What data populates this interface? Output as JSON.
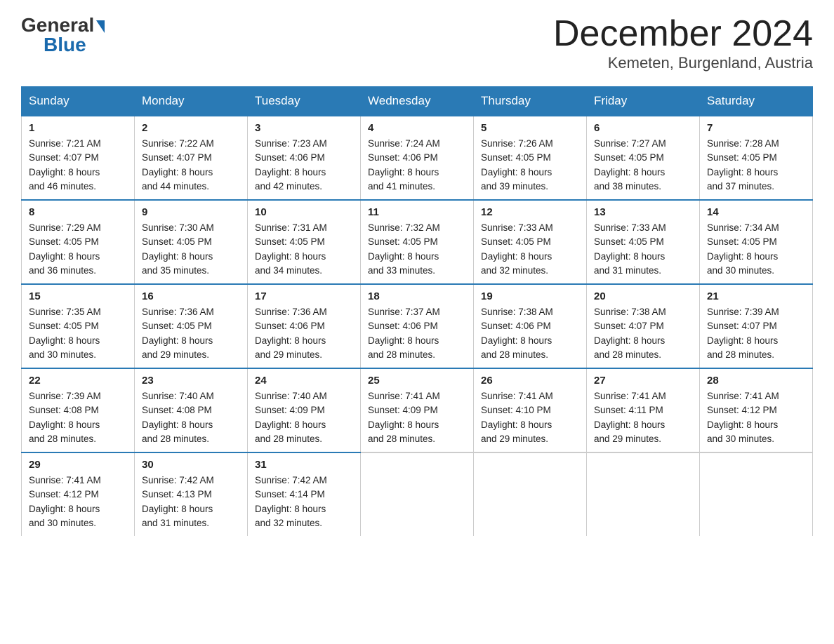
{
  "logo": {
    "general": "General",
    "blue": "Blue",
    "triangle": "▶"
  },
  "title": "December 2024",
  "location": "Kemeten, Burgenland, Austria",
  "days_of_week": [
    "Sunday",
    "Monday",
    "Tuesday",
    "Wednesday",
    "Thursday",
    "Friday",
    "Saturday"
  ],
  "weeks": [
    [
      {
        "day": "1",
        "sunrise": "7:21 AM",
        "sunset": "4:07 PM",
        "daylight": "8 hours and 46 minutes."
      },
      {
        "day": "2",
        "sunrise": "7:22 AM",
        "sunset": "4:07 PM",
        "daylight": "8 hours and 44 minutes."
      },
      {
        "day": "3",
        "sunrise": "7:23 AM",
        "sunset": "4:06 PM",
        "daylight": "8 hours and 42 minutes."
      },
      {
        "day": "4",
        "sunrise": "7:24 AM",
        "sunset": "4:06 PM",
        "daylight": "8 hours and 41 minutes."
      },
      {
        "day": "5",
        "sunrise": "7:26 AM",
        "sunset": "4:05 PM",
        "daylight": "8 hours and 39 minutes."
      },
      {
        "day": "6",
        "sunrise": "7:27 AM",
        "sunset": "4:05 PM",
        "daylight": "8 hours and 38 minutes."
      },
      {
        "day": "7",
        "sunrise": "7:28 AM",
        "sunset": "4:05 PM",
        "daylight": "8 hours and 37 minutes."
      }
    ],
    [
      {
        "day": "8",
        "sunrise": "7:29 AM",
        "sunset": "4:05 PM",
        "daylight": "8 hours and 36 minutes."
      },
      {
        "day": "9",
        "sunrise": "7:30 AM",
        "sunset": "4:05 PM",
        "daylight": "8 hours and 35 minutes."
      },
      {
        "day": "10",
        "sunrise": "7:31 AM",
        "sunset": "4:05 PM",
        "daylight": "8 hours and 34 minutes."
      },
      {
        "day": "11",
        "sunrise": "7:32 AM",
        "sunset": "4:05 PM",
        "daylight": "8 hours and 33 minutes."
      },
      {
        "day": "12",
        "sunrise": "7:33 AM",
        "sunset": "4:05 PM",
        "daylight": "8 hours and 32 minutes."
      },
      {
        "day": "13",
        "sunrise": "7:33 AM",
        "sunset": "4:05 PM",
        "daylight": "8 hours and 31 minutes."
      },
      {
        "day": "14",
        "sunrise": "7:34 AM",
        "sunset": "4:05 PM",
        "daylight": "8 hours and 30 minutes."
      }
    ],
    [
      {
        "day": "15",
        "sunrise": "7:35 AM",
        "sunset": "4:05 PM",
        "daylight": "8 hours and 30 minutes."
      },
      {
        "day": "16",
        "sunrise": "7:36 AM",
        "sunset": "4:05 PM",
        "daylight": "8 hours and 29 minutes."
      },
      {
        "day": "17",
        "sunrise": "7:36 AM",
        "sunset": "4:06 PM",
        "daylight": "8 hours and 29 minutes."
      },
      {
        "day": "18",
        "sunrise": "7:37 AM",
        "sunset": "4:06 PM",
        "daylight": "8 hours and 28 minutes."
      },
      {
        "day": "19",
        "sunrise": "7:38 AM",
        "sunset": "4:06 PM",
        "daylight": "8 hours and 28 minutes."
      },
      {
        "day": "20",
        "sunrise": "7:38 AM",
        "sunset": "4:07 PM",
        "daylight": "8 hours and 28 minutes."
      },
      {
        "day": "21",
        "sunrise": "7:39 AM",
        "sunset": "4:07 PM",
        "daylight": "8 hours and 28 minutes."
      }
    ],
    [
      {
        "day": "22",
        "sunrise": "7:39 AM",
        "sunset": "4:08 PM",
        "daylight": "8 hours and 28 minutes."
      },
      {
        "day": "23",
        "sunrise": "7:40 AM",
        "sunset": "4:08 PM",
        "daylight": "8 hours and 28 minutes."
      },
      {
        "day": "24",
        "sunrise": "7:40 AM",
        "sunset": "4:09 PM",
        "daylight": "8 hours and 28 minutes."
      },
      {
        "day": "25",
        "sunrise": "7:41 AM",
        "sunset": "4:09 PM",
        "daylight": "8 hours and 28 minutes."
      },
      {
        "day": "26",
        "sunrise": "7:41 AM",
        "sunset": "4:10 PM",
        "daylight": "8 hours and 29 minutes."
      },
      {
        "day": "27",
        "sunrise": "7:41 AM",
        "sunset": "4:11 PM",
        "daylight": "8 hours and 29 minutes."
      },
      {
        "day": "28",
        "sunrise": "7:41 AM",
        "sunset": "4:12 PM",
        "daylight": "8 hours and 30 minutes."
      }
    ],
    [
      {
        "day": "29",
        "sunrise": "7:41 AM",
        "sunset": "4:12 PM",
        "daylight": "8 hours and 30 minutes."
      },
      {
        "day": "30",
        "sunrise": "7:42 AM",
        "sunset": "4:13 PM",
        "daylight": "8 hours and 31 minutes."
      },
      {
        "day": "31",
        "sunrise": "7:42 AM",
        "sunset": "4:14 PM",
        "daylight": "8 hours and 32 minutes."
      },
      null,
      null,
      null,
      null
    ]
  ],
  "labels": {
    "sunrise": "Sunrise:",
    "sunset": "Sunset:",
    "daylight": "Daylight:"
  }
}
